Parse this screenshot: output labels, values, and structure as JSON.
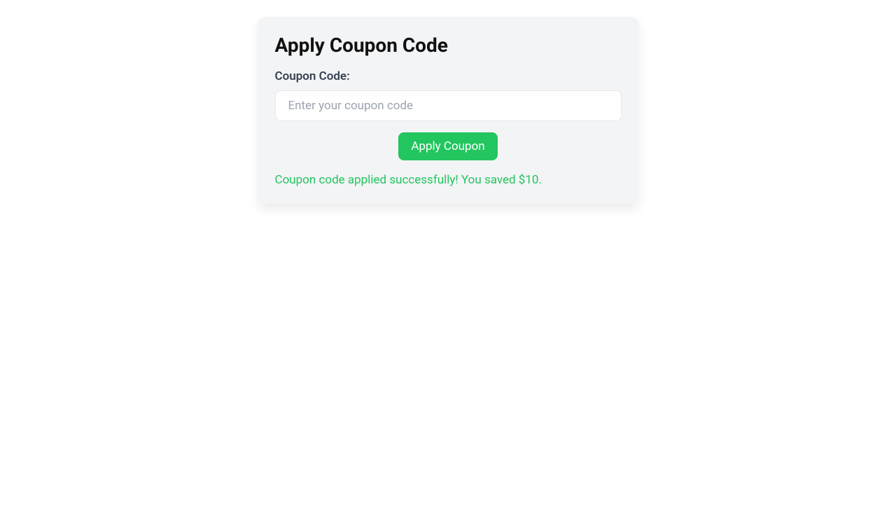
{
  "card": {
    "title": "Apply Coupon Code",
    "field_label": "Coupon Code:",
    "input_placeholder": "Enter your coupon code",
    "input_value": "",
    "button_label": "Apply Coupon",
    "success_message": "Coupon code applied successfully! You saved $10."
  }
}
